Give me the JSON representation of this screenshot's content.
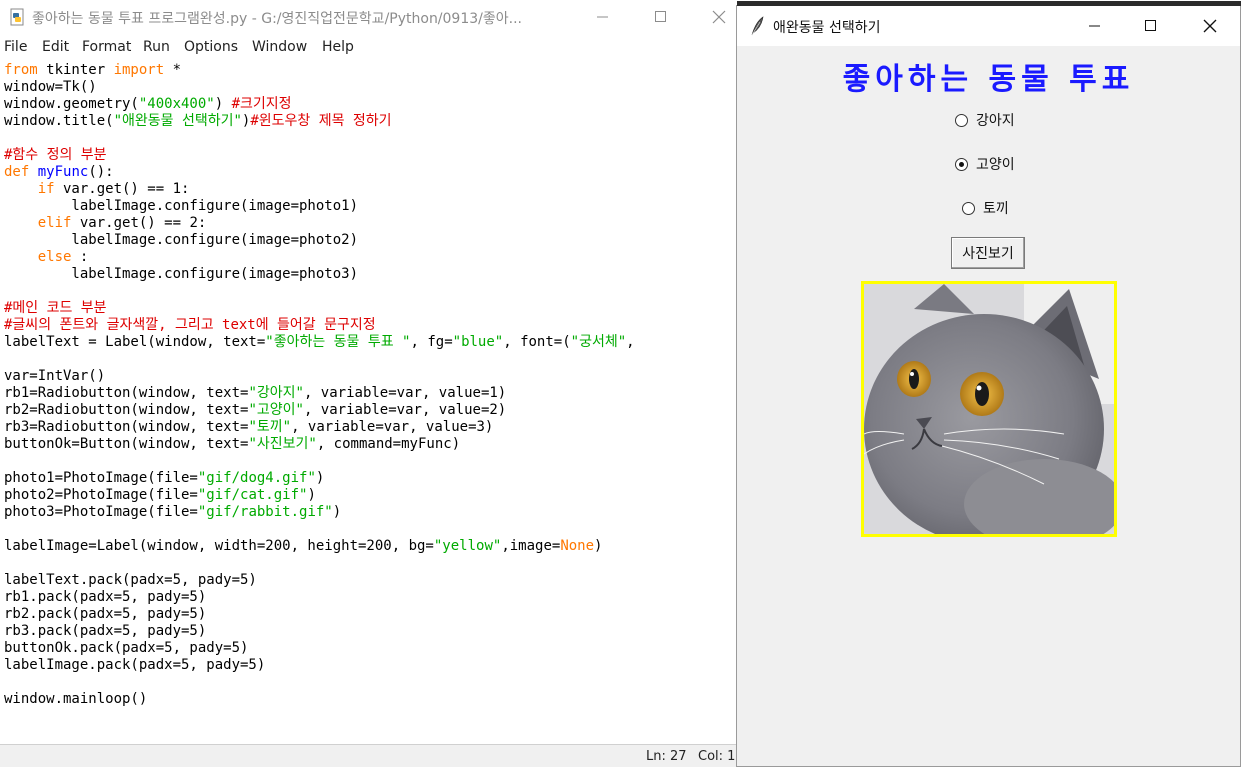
{
  "idle": {
    "title": "좋아하는 동물 투표 프로그램완성.py - G:/영진직업전문학교/Python/0913/좋아...",
    "menu": [
      "File",
      "Edit",
      "Format",
      "Run",
      "Options",
      "Window",
      "Help"
    ],
    "status": {
      "ln": "Ln: 27",
      "col": "Col: 1"
    }
  },
  "tk": {
    "window_title": "애완동물 선택하기",
    "title_label": "좋아하는 동물 투표",
    "radios": [
      {
        "label": "강아지",
        "selected": false
      },
      {
        "label": "고양이",
        "selected": true
      },
      {
        "label": "토끼",
        "selected": false
      }
    ],
    "button_label": "사진보기",
    "image": {
      "subject": "grey-cat-photo",
      "bg_color": "#ffff00"
    }
  },
  "colors": {
    "keyword": "#ff7700",
    "string": "#00aa00",
    "comment": "#dd0000",
    "defname": "#0000ff",
    "title_blue": "#1a1aff"
  }
}
